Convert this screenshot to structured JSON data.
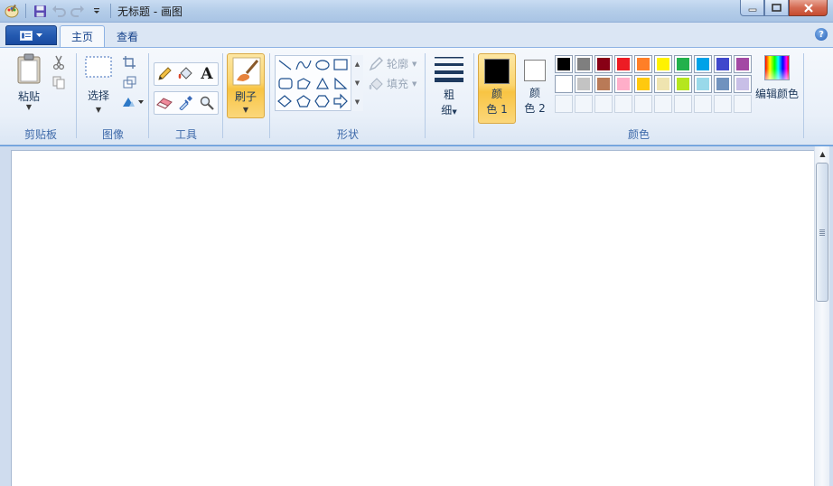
{
  "window": {
    "title": "无标题 - 画图",
    "minimize_glyph": "▁",
    "maximize_glyph": "□",
    "close_glyph": "✕"
  },
  "tabs": [
    {
      "label": "主页",
      "active": true
    },
    {
      "label": "查看",
      "active": false
    }
  ],
  "help_glyph": "?",
  "clipboard": {
    "paste_label": "粘贴",
    "group_label": "剪贴板"
  },
  "image": {
    "select_label": "选择",
    "group_label": "图像"
  },
  "tools": {
    "group_label": "工具"
  },
  "brushes": {
    "label": "刷子"
  },
  "shapes": {
    "outline_label": "轮廓",
    "fill_label": "填充",
    "group_label": "形状"
  },
  "size": {
    "label_line1": "粗",
    "label_line2": "细"
  },
  "colors": {
    "color1_line1": "颜",
    "color1_line2": "色 1",
    "color2_line1": "颜",
    "color2_line2": "色 2",
    "color1_value": "#000000",
    "color2_value": "#ffffff",
    "edit_label": "编辑颜色",
    "group_label": "颜色",
    "palette_row1": [
      "#000000",
      "#7f7f7f",
      "#880015",
      "#ed1c24",
      "#ff7f27",
      "#fff200",
      "#22b14c",
      "#00a2e8",
      "#3f48cc",
      "#a349a4"
    ],
    "palette_row2": [
      "#ffffff",
      "#c3c3c3",
      "#b97a57",
      "#ffaec9",
      "#ffc90e",
      "#efe4b0",
      "#b5e61d",
      "#99d9ea",
      "#7092be",
      "#c8bfe7"
    ]
  }
}
